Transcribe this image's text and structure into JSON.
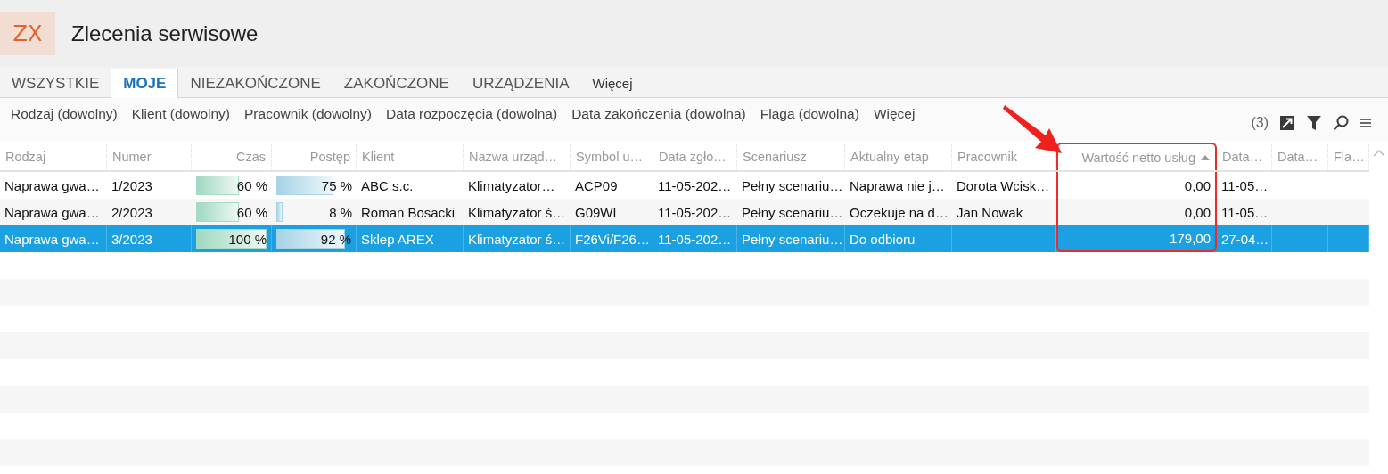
{
  "app": {
    "logo": "ZX",
    "title": "Zlecenia serwisowe"
  },
  "tabs": [
    {
      "label": "WSZYSTKIE",
      "selected": false
    },
    {
      "label": "MOJE",
      "selected": true
    },
    {
      "label": "NIEZAKOŃCZONE",
      "selected": false
    },
    {
      "label": "ZAKOŃCZONE",
      "selected": false
    },
    {
      "label": "URZĄDZENIA",
      "selected": false
    },
    {
      "label": "Więcej",
      "selected": false
    }
  ],
  "filters": [
    "Rodzaj (dowolny)",
    "Klient (dowolny)",
    "Pracownik (dowolny)",
    "Data rozpoczęcia (dowolna)",
    "Data zakończenia (dowolna)",
    "Flaga (dowolna)",
    "Więcej"
  ],
  "count": "(3)",
  "table": {
    "columns": [
      {
        "label": "Rodzaj",
        "kind": "text"
      },
      {
        "label": "Numer",
        "kind": "text"
      },
      {
        "label": "Czas",
        "kind": "time"
      },
      {
        "label": "Postęp",
        "kind": "progress"
      },
      {
        "label": "Klient",
        "kind": "text"
      },
      {
        "label": "Nazwa urząd…",
        "kind": "text"
      },
      {
        "label": "Symbol u…",
        "kind": "text"
      },
      {
        "label": "Data zgło…",
        "kind": "text"
      },
      {
        "label": "Scenariusz",
        "kind": "text"
      },
      {
        "label": "Aktualny etap",
        "kind": "text"
      },
      {
        "label": "Pracownik",
        "kind": "text"
      },
      {
        "label": "Wartość netto usług",
        "kind": "number",
        "sorted": true,
        "highlighted": true
      },
      {
        "label": "Data…",
        "kind": "text"
      },
      {
        "label": "Data…",
        "kind": "text"
      },
      {
        "label": "Fla…",
        "kind": "text"
      }
    ],
    "rows": [
      {
        "selected": false,
        "cells": [
          "Naprawa gwa…",
          "1/2023",
          {
            "level": 0.6,
            "label": "60 %"
          },
          {
            "level": 0.75,
            "label": "75 %"
          },
          "ABC s.c.",
          "Klimatyzator…",
          "ACP09",
          "11-05-202…",
          "Pełny scenariu…",
          "Naprawa nie j…",
          "Dorota Wcisk…",
          "0,00",
          "11-05…",
          null,
          null
        ]
      },
      {
        "selected": false,
        "cells": [
          "Naprawa gwa…",
          "2/2023",
          {
            "level": 0.6,
            "label": "60 %"
          },
          {
            "level": 0.08,
            "label": "8 %"
          },
          "Roman Bosacki",
          "Klimatyzator ś…",
          "G09WL",
          "11-05-202…",
          "Pełny scenariu…",
          "Oczekuje na d…",
          "Jan Nowak",
          "0,00",
          "11-05…",
          null,
          null
        ]
      },
      {
        "selected": true,
        "cells": [
          "Naprawa gwa…",
          "3/2023",
          {
            "level": 1,
            "label": "100 %"
          },
          {
            "level": 0.92,
            "label": "92 %"
          },
          "Sklep AREX",
          "Klimatyzator ś…",
          "F26Vi/F26…",
          "11-05-202…",
          "Pełny scenariu…",
          "Do odbioru",
          null,
          "179,00",
          "27-04…",
          null,
          null
        ]
      }
    ]
  }
}
